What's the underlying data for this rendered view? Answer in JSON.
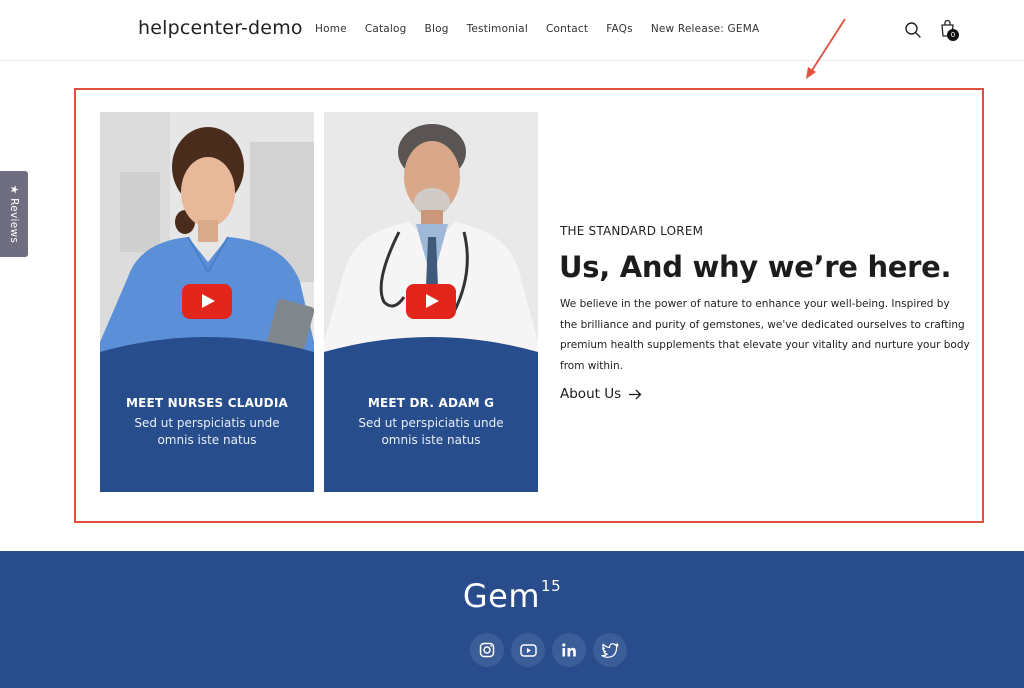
{
  "header": {
    "brand": "helpcenter-demo",
    "nav": [
      "Home",
      "Catalog",
      "Blog",
      "Testimonial",
      "Contact",
      "FAQs",
      "New Release: GEMA"
    ],
    "cart_count": "0"
  },
  "reviews_tab": {
    "label": "Reviews",
    "icon": "star-icon"
  },
  "annotation": {
    "color": "#e1503e"
  },
  "cards": [
    {
      "title": "MEET NURSES CLAUDIA",
      "subtitle": "Sed ut perspiciatis unde omnis iste natus"
    },
    {
      "title": "MEET DR. ADAM G",
      "subtitle": "Sed ut perspiciatis unde omnis iste natus"
    }
  ],
  "about": {
    "eyebrow": "THE STANDARD LOREM",
    "heading": "Us, And why we’re here.",
    "body": "We believe in the power of nature to enhance your well-being. Inspired by the brilliance and purity of gemstones, we've dedicated ourselves to crafting premium health supplements that elevate your vitality and nurture your body from within.",
    "link_label": "About Us"
  },
  "footer": {
    "logo": "Gem",
    "logo_superscript": "15",
    "socials": [
      "instagram-icon",
      "youtube-icon",
      "linkedin-icon",
      "twitter-icon"
    ],
    "background": "#284c8c"
  },
  "colors": {
    "card_blue": "#284d8d",
    "play_red": "#e3261c"
  }
}
